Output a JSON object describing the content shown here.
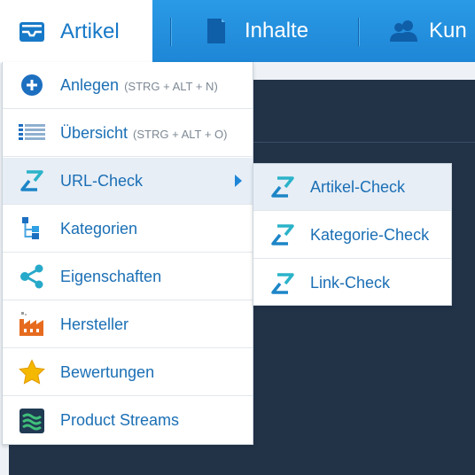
{
  "topbar": {
    "tabs": [
      {
        "label": "Artikel",
        "icon": "inbox-tray-icon",
        "active": true
      },
      {
        "label": "Inhalte",
        "icon": "document-icon",
        "active": false
      },
      {
        "label": "Kun",
        "icon": "users-icon",
        "active": false
      }
    ]
  },
  "menu": {
    "items": [
      {
        "label": "Anlegen",
        "shortcut": "(STRG + ALT + N)",
        "icon": "plus-circle-icon"
      },
      {
        "label": "Übersicht",
        "shortcut": "(STRG + ALT + O)",
        "icon": "list-icon"
      },
      {
        "label": "URL-Check",
        "shortcut": "",
        "icon": "url-check-icon",
        "has_submenu": true
      },
      {
        "label": "Kategorien",
        "shortcut": "",
        "icon": "category-tree-icon"
      },
      {
        "label": "Eigenschaften",
        "shortcut": "",
        "icon": "share-nodes-icon"
      },
      {
        "label": "Hersteller",
        "shortcut": "",
        "icon": "factory-icon"
      },
      {
        "label": "Bewertungen",
        "shortcut": "",
        "icon": "star-icon"
      },
      {
        "label": "Product Streams",
        "shortcut": "",
        "icon": "streams-icon"
      }
    ]
  },
  "submenu": {
    "items": [
      {
        "label": "Artikel-Check",
        "icon": "url-check-icon"
      },
      {
        "label": "Kategorie-Check",
        "icon": "url-check-icon"
      },
      {
        "label": "Link-Check",
        "icon": "url-check-icon"
      }
    ]
  },
  "colors": {
    "topbar": "#1e86d6",
    "menu_text": "#1b6fb5",
    "content_bg": "#223348",
    "hover_bg": "#e7eef6"
  }
}
